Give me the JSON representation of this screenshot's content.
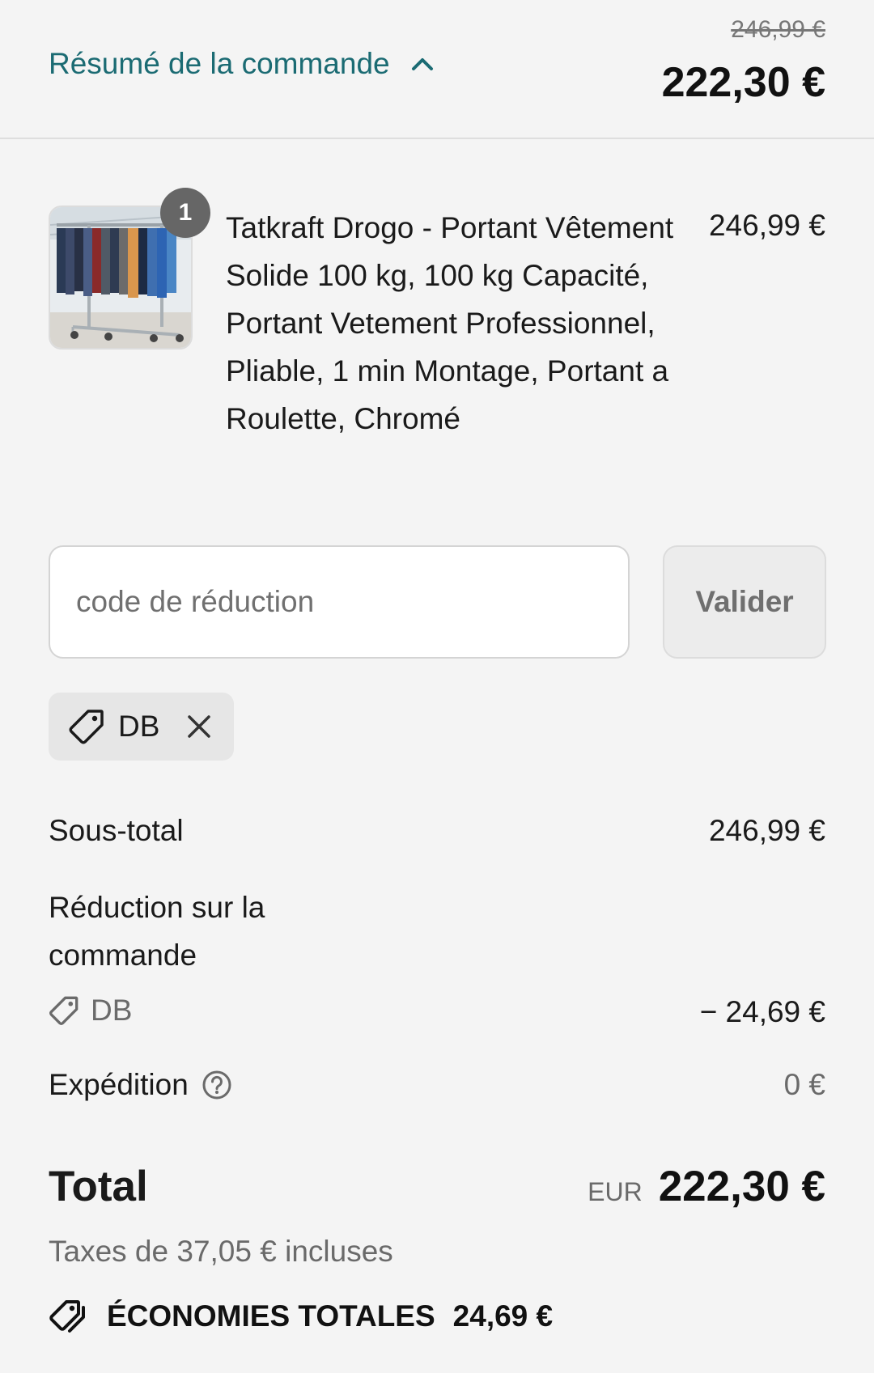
{
  "header": {
    "toggle_label": "Résumé de la commande",
    "original_price": "246,99 €",
    "total_price": "222,30 €"
  },
  "product": {
    "quantity": "1",
    "name": "Tatkraft Drogo - Portant Vêtement Solide 100 kg, 100 kg Capacité, Portant Vetement Professionnel, Pliable, 1 min Montage, Portant a Roulette, Chromé",
    "price": "246,99 €",
    "image_icon": "clothing-rack-image"
  },
  "discount": {
    "placeholder": "code de réduction",
    "button_label": "Valider",
    "applied_code": "DB"
  },
  "summary": {
    "subtotal_label": "Sous-total",
    "subtotal_value": "246,99 €",
    "reduction_label": "Réduction sur la commande",
    "reduction_code": "DB",
    "reduction_value": "− 24,69 €",
    "shipping_label": "Expédition",
    "shipping_value": "0 €"
  },
  "total": {
    "label": "Total",
    "currency": "EUR",
    "amount": "222,30 €",
    "taxes": "Taxes de 37,05 € incluses",
    "savings_label": "ÉCONOMIES TOTALES",
    "savings_amount": "24,69 €"
  },
  "colors": {
    "accent": "#1b6b73",
    "background": "#f4f4f4",
    "muted_text": "#6a6a6a"
  }
}
